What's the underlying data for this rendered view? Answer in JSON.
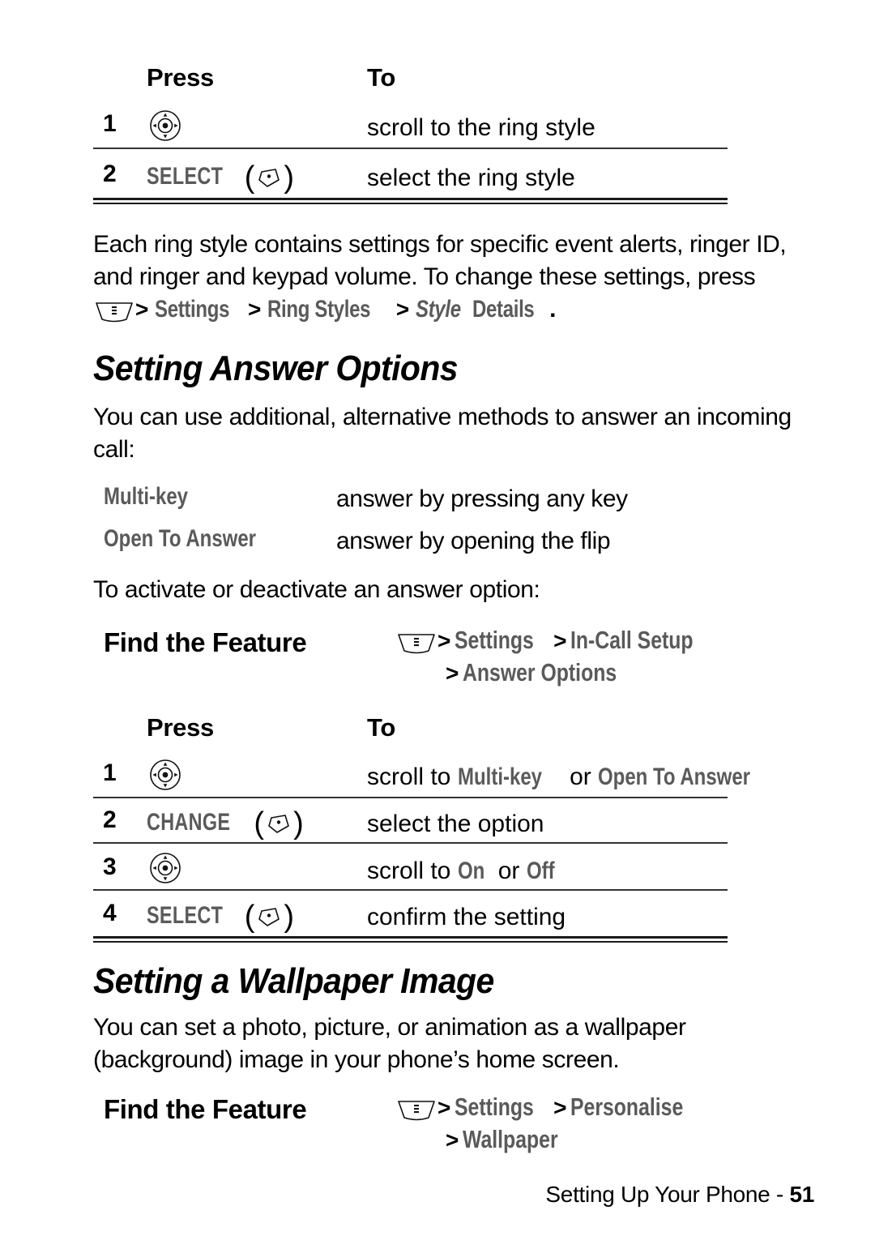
{
  "document": {
    "footer_text": "Setting Up Your Phone - ",
    "footer_page": "51"
  },
  "table_ring_style": {
    "header_press": "Press",
    "header_to": "To",
    "rows": [
      {
        "num": "1",
        "press_icon": "navigation-key-icon",
        "press_label": "",
        "to": "scroll to the ring style"
      },
      {
        "num": "2",
        "press_icon": "soft-key-right-icon",
        "press_label": "SELECT",
        "to": "select the ring style"
      }
    ]
  },
  "paragraph_ring_style": {
    "line1": "Each ring style contains settings for specific event alerts, ringer ID,",
    "line2": "and ringer and keypad volume. To change these settings, press",
    "path_icon": "menu-key-icon",
    "path_sep1": ">",
    "path_item1": "Settings",
    "path_sep2": ">",
    "path_item2": "Ring Styles",
    "path_sep3": ">",
    "path_item3_italic": "Style",
    "path_item3_rest": " Details",
    "path_period": "."
  },
  "section_answer_options": {
    "heading": "Setting Answer Options",
    "intro_line1": "You can use additional, alternative methods to answer an incoming",
    "intro_line2": "call:",
    "definitions": [
      {
        "term": "Multi-key",
        "desc": "answer by pressing any key"
      },
      {
        "term": "Open To Answer",
        "desc": "answer by opening the flip"
      }
    ],
    "activate_line": "To activate or deactivate an answer option:",
    "find_the_feature_label": "Find the Feature",
    "find_path_icon": "menu-key-icon",
    "find_path_line1_sep1": ">",
    "find_path_line1_item1": "Settings",
    "find_path_line1_sep2": ">",
    "find_path_line1_item2": "In-Call Setup",
    "find_path_line2_sep": ">",
    "find_path_line2_item": "Answer Options"
  },
  "table_answer_options": {
    "header_press": "Press",
    "header_to": "To",
    "rows": [
      {
        "num": "1",
        "press_icon": "navigation-key-icon",
        "press_label": "",
        "to_prefix": "scroll to ",
        "to_menu1": "Multi-key",
        "to_middle": " or ",
        "to_menu2": "Open To Answer",
        "to_suffix": ""
      },
      {
        "num": "2",
        "press_icon": "soft-key-right-icon",
        "press_label": "CHANGE",
        "to_prefix": "select the option",
        "to_menu1": "",
        "to_middle": "",
        "to_menu2": "",
        "to_suffix": ""
      },
      {
        "num": "3",
        "press_icon": "navigation-key-icon",
        "press_label": "",
        "to_prefix": "scroll to ",
        "to_menu1": "On",
        "to_middle": " or ",
        "to_menu2": "Off",
        "to_suffix": ""
      },
      {
        "num": "4",
        "press_icon": "soft-key-right-icon",
        "press_label": "SELECT",
        "to_prefix": "confirm the setting",
        "to_menu1": "",
        "to_middle": "",
        "to_menu2": "",
        "to_suffix": ""
      }
    ]
  },
  "section_wallpaper": {
    "heading": "Setting a Wallpaper Image",
    "intro_line1": "You can set a photo, picture, or animation as a wallpaper",
    "intro_line2": "(background) image in your phone’s home screen.",
    "find_the_feature_label": "Find the Feature",
    "find_path_icon": "menu-key-icon",
    "find_path_line1_sep1": ">",
    "find_path_line1_item1": "Settings",
    "find_path_line1_sep2": ">",
    "find_path_line1_item2": "Personalise",
    "find_path_line2_sep": ">",
    "find_path_line2_item": "Wallpaper"
  },
  "colors": {
    "menu_gray": "#5a5a5a",
    "text_black": "#000000",
    "rule": "#1a1a1a"
  }
}
